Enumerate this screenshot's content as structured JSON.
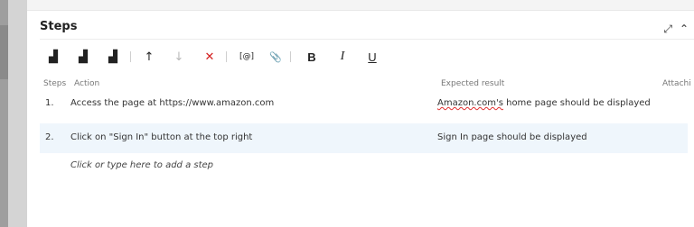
{
  "panel": {
    "title": "Steps"
  },
  "header_icons": [
    "expand-icon",
    "collapse-icon"
  ],
  "toolbar": [
    {
      "name": "insert-step-button",
      "glyph": "▟",
      "state": "enabled"
    },
    {
      "name": "insert-shared-steps-button",
      "glyph": "▟",
      "state": "enabled"
    },
    {
      "name": "create-shared-steps-button",
      "glyph": "▟",
      "state": "enabled"
    },
    {
      "name": "move-up-button",
      "glyph": "↑",
      "state": "enabled"
    },
    {
      "name": "move-down-button",
      "glyph": "↓",
      "state": "disabled"
    },
    {
      "name": "delete-step-button",
      "glyph": "✕",
      "state": "enabled"
    },
    {
      "name": "insert-parameter-button",
      "glyph": "[@]",
      "state": "enabled"
    },
    {
      "name": "attach-file-button",
      "glyph": "📎",
      "state": "enabled"
    },
    {
      "name": "bold-button",
      "glyph": "B",
      "state": "enabled"
    },
    {
      "name": "italic-button",
      "glyph": "I",
      "state": "enabled"
    },
    {
      "name": "underline-button",
      "glyph": "U",
      "state": "enabled"
    }
  ],
  "columns": {
    "steps": "Steps",
    "action": "Action",
    "expected": "Expected result",
    "attachments": "Attachi"
  },
  "rows": [
    {
      "num": "1.",
      "action": "Access the page at https://www.amazon.com",
      "expected_misspelled": "Amazon.com's",
      "expected_rest": " home page should be displayed"
    },
    {
      "num": "2.",
      "action": "Click on \"Sign In\" button at the top right",
      "expected": "Sign In page should be displayed"
    }
  ],
  "add_step_placeholder": "Click or type here to add a step",
  "colors": {
    "selected_row": "#eff6fc",
    "delete": "#d42020",
    "spelling": "#e03030"
  }
}
